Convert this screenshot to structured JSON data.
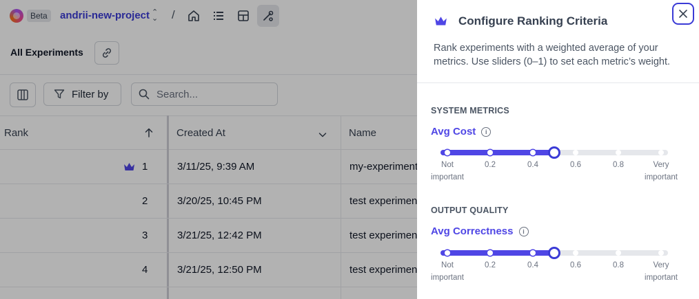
{
  "header": {
    "beta": "Beta",
    "project": "andrii-new-project",
    "separator": "/"
  },
  "page": {
    "title": "All Experiments"
  },
  "toolbar": {
    "filter_label": "Filter by",
    "search_placeholder": "Search..."
  },
  "table": {
    "columns": [
      "Rank",
      "Created At",
      "Name"
    ],
    "rows": [
      {
        "rank": "1",
        "created": "3/11/25, 9:39 AM",
        "name": "my-experiment"
      },
      {
        "rank": "2",
        "created": "3/20/25, 10:45 PM",
        "name": "test experiment"
      },
      {
        "rank": "3",
        "created": "3/21/25, 12:42 PM",
        "name": "test experiment"
      },
      {
        "rank": "4",
        "created": "3/21/25, 12:50 PM",
        "name": "test experiment"
      }
    ]
  },
  "panel": {
    "title": "Configure Ranking Criteria",
    "description": "Rank experiments with a weighted average of your metrics. Use sliders (0–1) to set each metric’s weight.",
    "sections": [
      {
        "heading": "SYSTEM METRICS",
        "metric": "Avg Cost",
        "weight": 0.5,
        "ticks": [
          "Not important",
          "0.2",
          "0.4",
          "0.6",
          "0.8",
          "Very important"
        ]
      },
      {
        "heading": "OUTPUT QUALITY",
        "metric": "Avg Correctness",
        "weight": 0.5,
        "ticks": [
          "Not important",
          "0.2",
          "0.4",
          "0.6",
          "0.8",
          "Very important"
        ]
      }
    ]
  },
  "colors": {
    "accent": "#4f46e5",
    "project": "#3b3bd6",
    "overlay": "rgba(0,0,0,0.30)"
  }
}
